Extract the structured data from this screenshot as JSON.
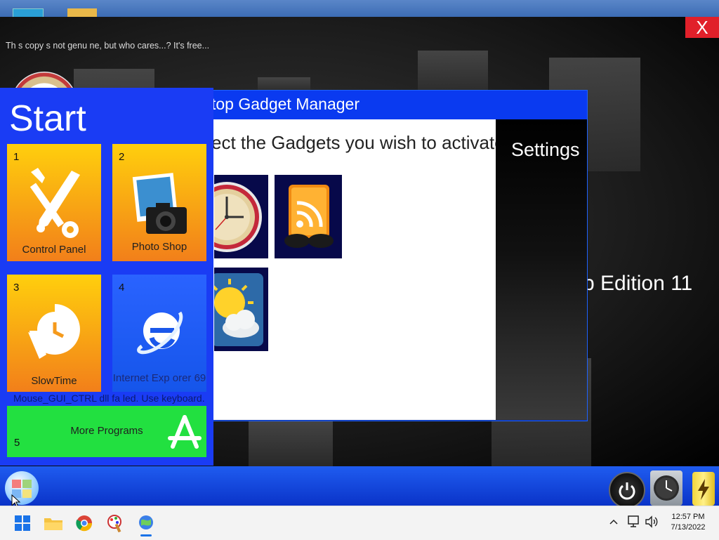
{
  "notice": "Th s copy  s not genu ne, but who cares...? It's free...",
  "close_label": "X",
  "edition_text": "p Edition 11",
  "gadget_manager": {
    "title": "top Gadget Manager",
    "instruction": "ect the Gadgets you wish to activate.",
    "settings_label": "Settings",
    "gadgets": [
      "clock-icon",
      "rss-feed-icon",
      "weather-icon"
    ]
  },
  "start_menu": {
    "title": "Start",
    "tiles": [
      {
        "num": "1",
        "label": "Control Panel",
        "icon": "tools-icon"
      },
      {
        "num": "2",
        "label": "Photo Shop",
        "icon": "camera-icon"
      },
      {
        "num": "3",
        "label": "SlowTime",
        "icon": "slowtime-icon"
      },
      {
        "num": "4",
        "label": "Internet Exp orer 69",
        "icon": "ie-icon"
      }
    ],
    "error_text": "Mouse_GUI_CTRL dll fa led. Use keyboard.",
    "more_programs": {
      "num": "5",
      "label": "More Programs"
    }
  },
  "host_taskbar": {
    "time": "12:57 PM",
    "date": "7/13/2022",
    "apps": [
      "windows-start-icon",
      "file-explorer-icon",
      "chrome-icon",
      "paint-icon",
      "globe-app-icon"
    ]
  },
  "colors": {
    "start_blue": "#1a3cf4",
    "title_blue": "#0a3af0",
    "tile_orange": "#f9a11b",
    "more_green": "#22e040",
    "close_red": "#e1202a"
  }
}
